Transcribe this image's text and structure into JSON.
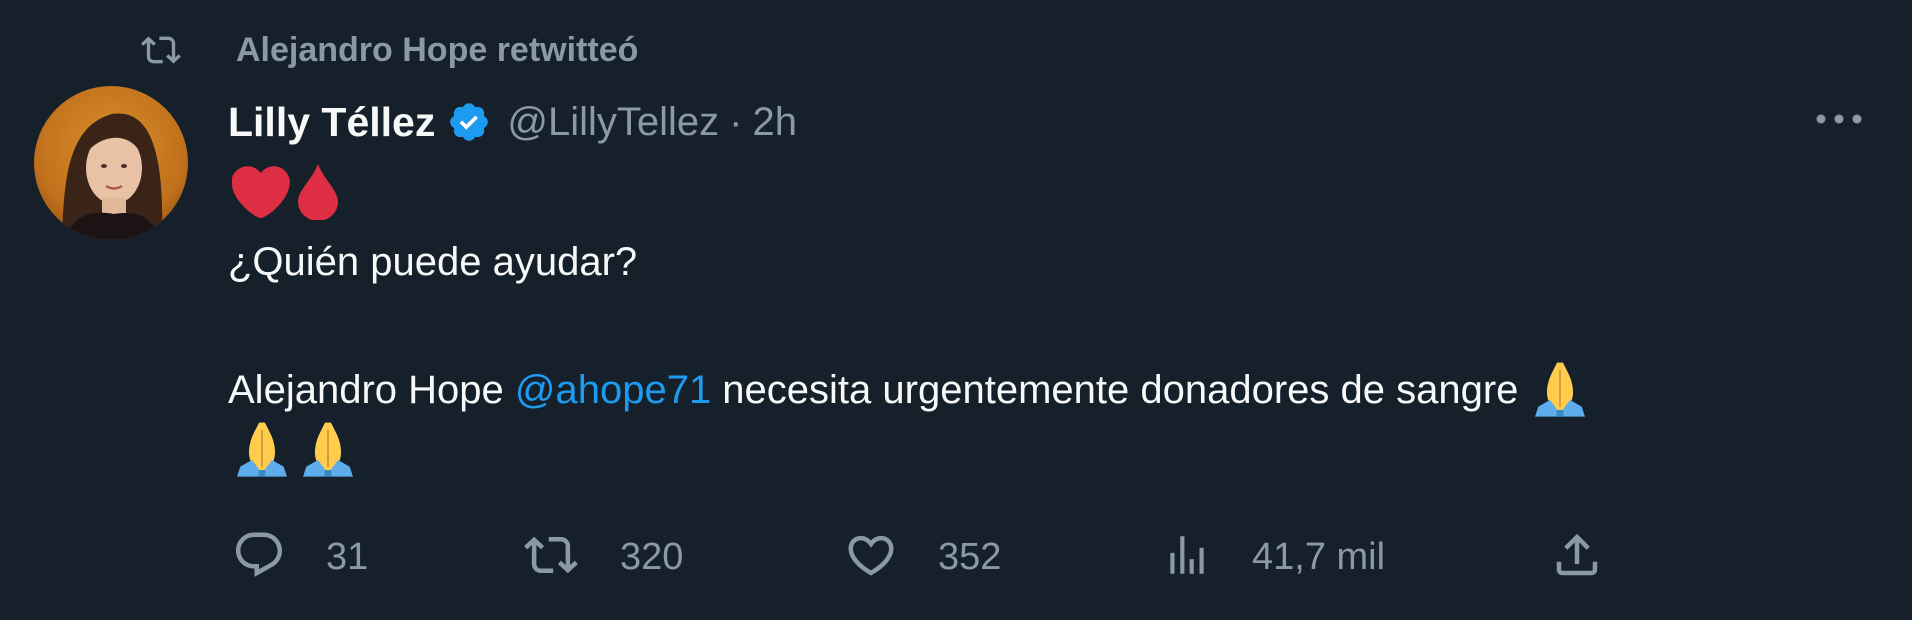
{
  "retweet_context": {
    "text": "Alejandro Hope retwitteó",
    "icon": "retweet-icon"
  },
  "author": {
    "display_name": "Lilly Téllez",
    "verified": true,
    "handle": "@LillyTellez",
    "separator": "·",
    "timestamp": "2h"
  },
  "tweet": {
    "emojis_line1": [
      "red-heart-emoji",
      "drop-of-blood-emoji"
    ],
    "line1": "¿Quién puede ayudar?",
    "line2_prefix": "Alejandro Hope ",
    "mention": "@ahope71",
    "line2_suffix": " necesita urgentemente donadores de sangre ",
    "trailing_emojis": [
      "folded-hands-emoji",
      "folded-hands-emoji",
      "folded-hands-emoji"
    ]
  },
  "actions": {
    "replies": "31",
    "retweets": "320",
    "likes": "352",
    "views": "41,7 mil"
  },
  "colors": {
    "background": "#15202b",
    "text": "#f7f9f9",
    "secondary_text": "#8b98a5",
    "accent": "#1d9bf0",
    "heart": "#e0245e"
  }
}
